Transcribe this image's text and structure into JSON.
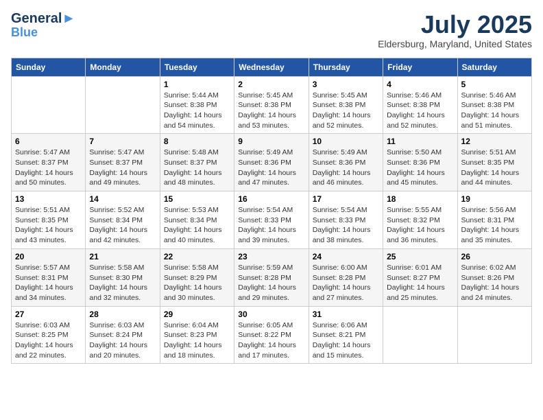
{
  "header": {
    "logo_line1": "General",
    "logo_line2": "Blue",
    "month": "July 2025",
    "location": "Eldersburg, Maryland, United States"
  },
  "weekdays": [
    "Sunday",
    "Monday",
    "Tuesday",
    "Wednesday",
    "Thursday",
    "Friday",
    "Saturday"
  ],
  "weeks": [
    [
      {
        "day": "",
        "info": ""
      },
      {
        "day": "",
        "info": ""
      },
      {
        "day": "1",
        "info": "Sunrise: 5:44 AM\nSunset: 8:38 PM\nDaylight: 14 hours and 54 minutes."
      },
      {
        "day": "2",
        "info": "Sunrise: 5:45 AM\nSunset: 8:38 PM\nDaylight: 14 hours and 53 minutes."
      },
      {
        "day": "3",
        "info": "Sunrise: 5:45 AM\nSunset: 8:38 PM\nDaylight: 14 hours and 52 minutes."
      },
      {
        "day": "4",
        "info": "Sunrise: 5:46 AM\nSunset: 8:38 PM\nDaylight: 14 hours and 52 minutes."
      },
      {
        "day": "5",
        "info": "Sunrise: 5:46 AM\nSunset: 8:38 PM\nDaylight: 14 hours and 51 minutes."
      }
    ],
    [
      {
        "day": "6",
        "info": "Sunrise: 5:47 AM\nSunset: 8:37 PM\nDaylight: 14 hours and 50 minutes."
      },
      {
        "day": "7",
        "info": "Sunrise: 5:47 AM\nSunset: 8:37 PM\nDaylight: 14 hours and 49 minutes."
      },
      {
        "day": "8",
        "info": "Sunrise: 5:48 AM\nSunset: 8:37 PM\nDaylight: 14 hours and 48 minutes."
      },
      {
        "day": "9",
        "info": "Sunrise: 5:49 AM\nSunset: 8:36 PM\nDaylight: 14 hours and 47 minutes."
      },
      {
        "day": "10",
        "info": "Sunrise: 5:49 AM\nSunset: 8:36 PM\nDaylight: 14 hours and 46 minutes."
      },
      {
        "day": "11",
        "info": "Sunrise: 5:50 AM\nSunset: 8:36 PM\nDaylight: 14 hours and 45 minutes."
      },
      {
        "day": "12",
        "info": "Sunrise: 5:51 AM\nSunset: 8:35 PM\nDaylight: 14 hours and 44 minutes."
      }
    ],
    [
      {
        "day": "13",
        "info": "Sunrise: 5:51 AM\nSunset: 8:35 PM\nDaylight: 14 hours and 43 minutes."
      },
      {
        "day": "14",
        "info": "Sunrise: 5:52 AM\nSunset: 8:34 PM\nDaylight: 14 hours and 42 minutes."
      },
      {
        "day": "15",
        "info": "Sunrise: 5:53 AM\nSunset: 8:34 PM\nDaylight: 14 hours and 40 minutes."
      },
      {
        "day": "16",
        "info": "Sunrise: 5:54 AM\nSunset: 8:33 PM\nDaylight: 14 hours and 39 minutes."
      },
      {
        "day": "17",
        "info": "Sunrise: 5:54 AM\nSunset: 8:33 PM\nDaylight: 14 hours and 38 minutes."
      },
      {
        "day": "18",
        "info": "Sunrise: 5:55 AM\nSunset: 8:32 PM\nDaylight: 14 hours and 36 minutes."
      },
      {
        "day": "19",
        "info": "Sunrise: 5:56 AM\nSunset: 8:31 PM\nDaylight: 14 hours and 35 minutes."
      }
    ],
    [
      {
        "day": "20",
        "info": "Sunrise: 5:57 AM\nSunset: 8:31 PM\nDaylight: 14 hours and 34 minutes."
      },
      {
        "day": "21",
        "info": "Sunrise: 5:58 AM\nSunset: 8:30 PM\nDaylight: 14 hours and 32 minutes."
      },
      {
        "day": "22",
        "info": "Sunrise: 5:58 AM\nSunset: 8:29 PM\nDaylight: 14 hours and 30 minutes."
      },
      {
        "day": "23",
        "info": "Sunrise: 5:59 AM\nSunset: 8:28 PM\nDaylight: 14 hours and 29 minutes."
      },
      {
        "day": "24",
        "info": "Sunrise: 6:00 AM\nSunset: 8:28 PM\nDaylight: 14 hours and 27 minutes."
      },
      {
        "day": "25",
        "info": "Sunrise: 6:01 AM\nSunset: 8:27 PM\nDaylight: 14 hours and 25 minutes."
      },
      {
        "day": "26",
        "info": "Sunrise: 6:02 AM\nSunset: 8:26 PM\nDaylight: 14 hours and 24 minutes."
      }
    ],
    [
      {
        "day": "27",
        "info": "Sunrise: 6:03 AM\nSunset: 8:25 PM\nDaylight: 14 hours and 22 minutes."
      },
      {
        "day": "28",
        "info": "Sunrise: 6:03 AM\nSunset: 8:24 PM\nDaylight: 14 hours and 20 minutes."
      },
      {
        "day": "29",
        "info": "Sunrise: 6:04 AM\nSunset: 8:23 PM\nDaylight: 14 hours and 18 minutes."
      },
      {
        "day": "30",
        "info": "Sunrise: 6:05 AM\nSunset: 8:22 PM\nDaylight: 14 hours and 17 minutes."
      },
      {
        "day": "31",
        "info": "Sunrise: 6:06 AM\nSunset: 8:21 PM\nDaylight: 14 hours and 15 minutes."
      },
      {
        "day": "",
        "info": ""
      },
      {
        "day": "",
        "info": ""
      }
    ]
  ]
}
